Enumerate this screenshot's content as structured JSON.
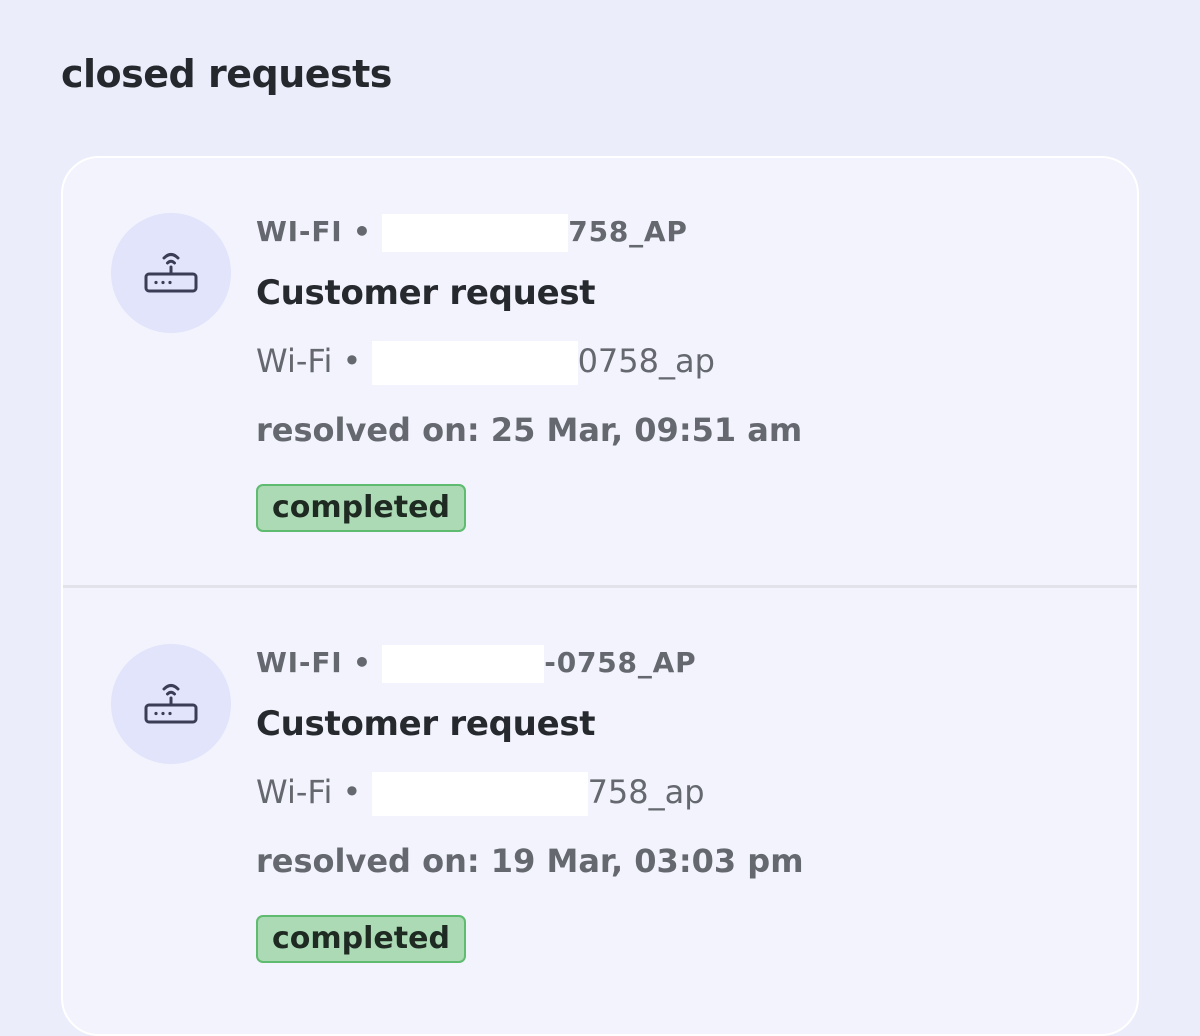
{
  "page": {
    "title": "closed requests"
  },
  "requests": [
    {
      "category": "WI-FI •",
      "network_suffix": "758_AP",
      "title": "Customer request",
      "sub_category": "Wi-Fi •",
      "sub_network_suffix": "0758_ap",
      "resolved": "resolved on: 25 Mar, 09:51 am",
      "status": "completed",
      "icon": "router-icon"
    },
    {
      "category": "WI-FI •",
      "network_suffix": "-0758_AP",
      "title": "Customer request",
      "sub_category": "Wi-Fi •",
      "sub_network_suffix": "758_ap",
      "resolved": "resolved on: 19 Mar, 03:03 pm",
      "status": "completed",
      "icon": "router-icon"
    }
  ],
  "colors": {
    "background": "#ebedfb",
    "card": "#f2f3fd",
    "icon_circle": "#e1e4fa",
    "badge_fill": "#abdab5",
    "badge_border": "#5fbb6f",
    "text_primary": "#26292e",
    "text_secondary": "#65686e"
  }
}
